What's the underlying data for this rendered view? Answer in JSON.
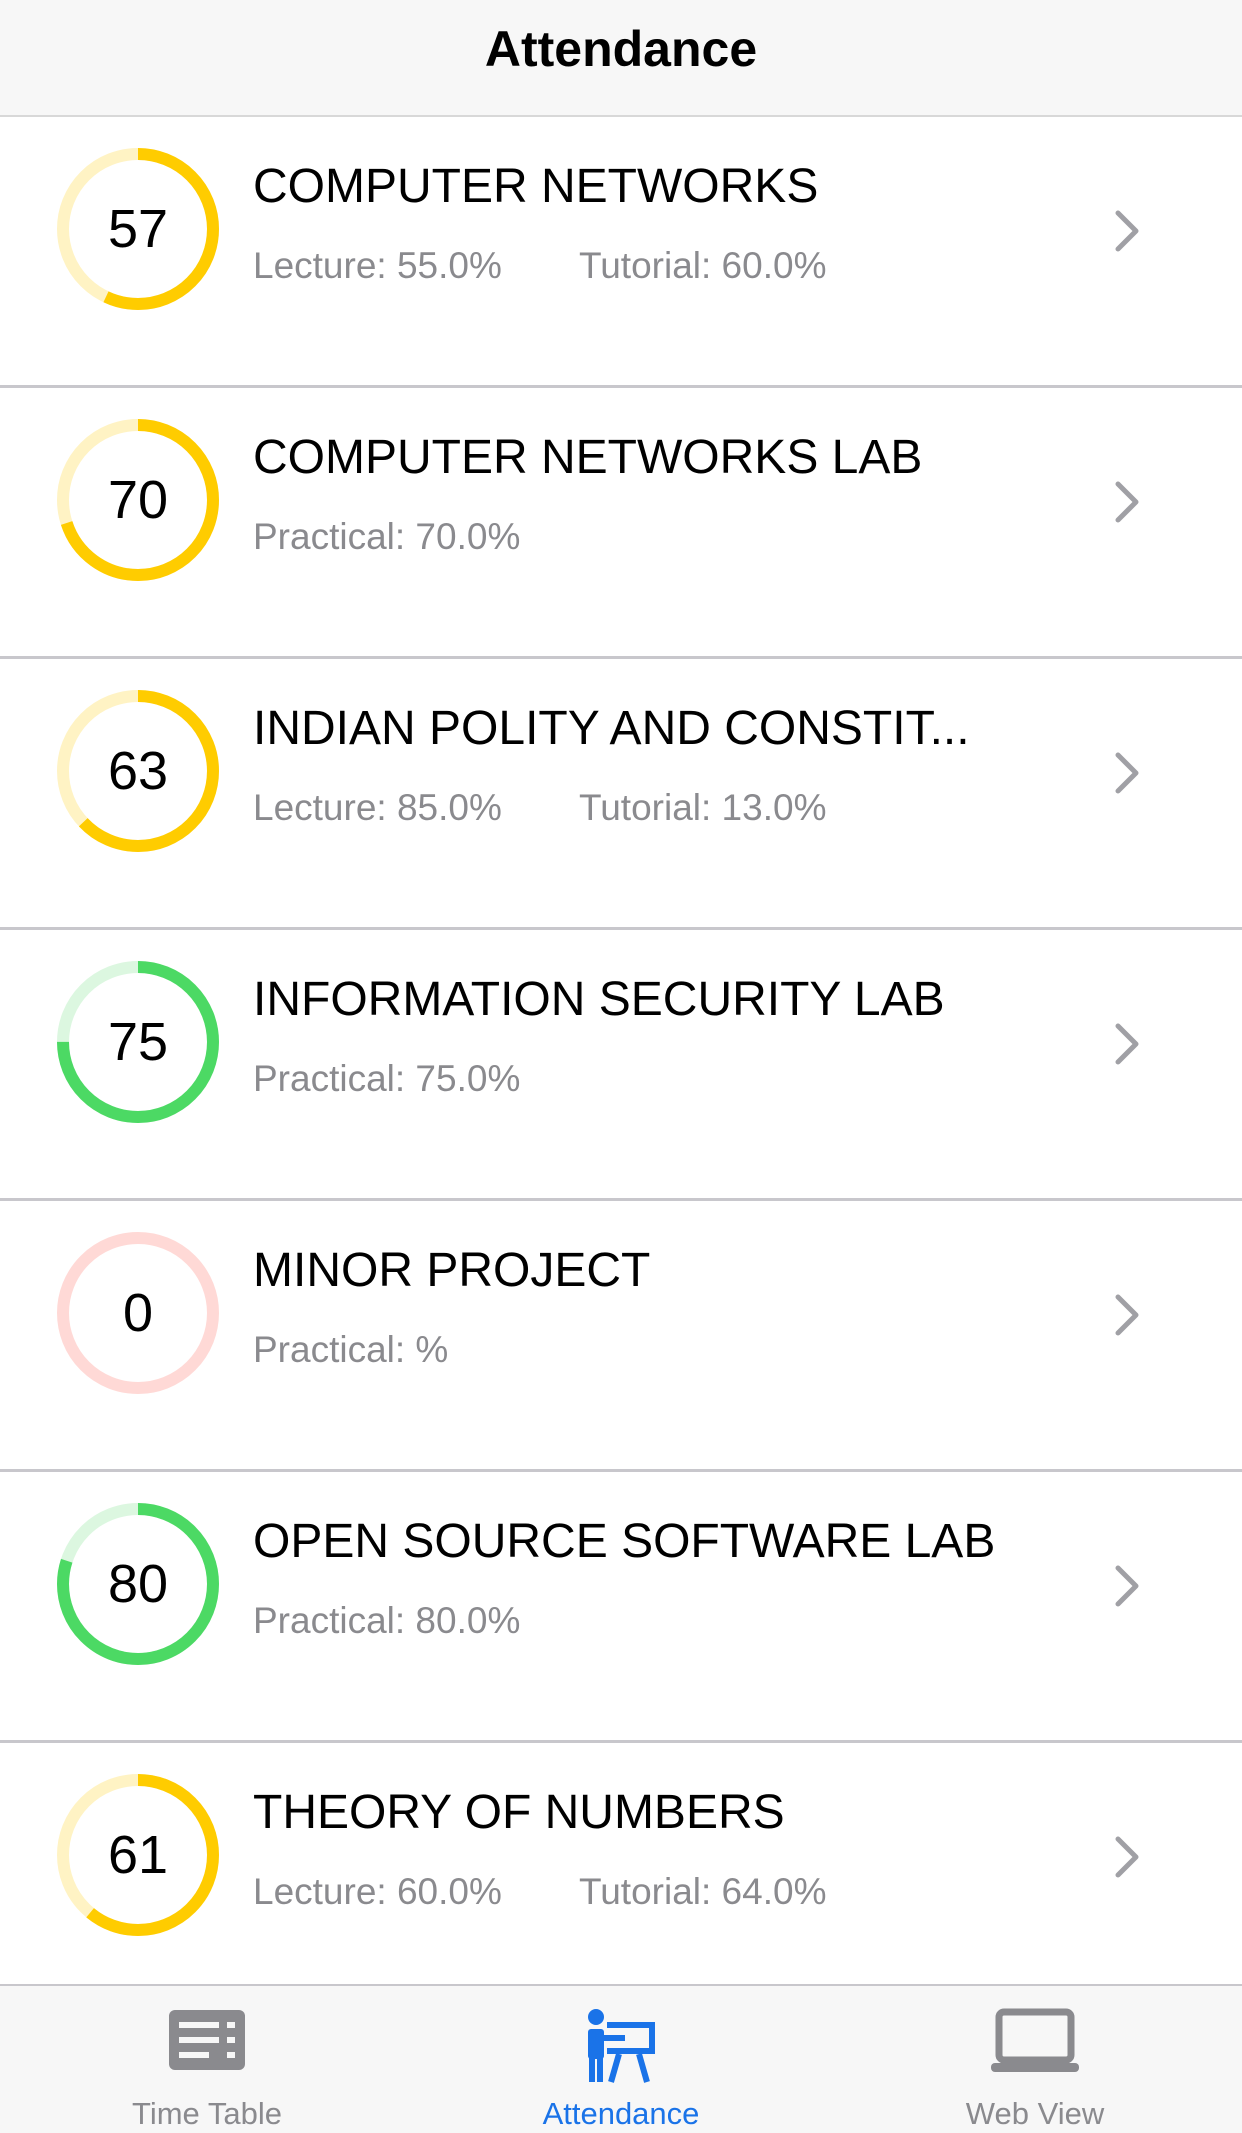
{
  "navbar": {
    "title": "Attendance"
  },
  "colors": {
    "yellow": "#ffcc00",
    "yellow_track": "#fff3c4",
    "green": "#4cd964",
    "green_track": "#dcf7e0",
    "red": "#ff3b30",
    "red_track": "#ffd9d6",
    "active_tab": "#1a73e8",
    "inactive_tab": "#8a8a8e"
  },
  "subjects": [
    {
      "name": "COMPUTER NETWORKS",
      "percent": "57",
      "status": "yellow",
      "detail1": "Lecture: 55.0%",
      "detail2": "Tutorial: 60.0%"
    },
    {
      "name": "COMPUTER NETWORKS LAB",
      "percent": "70",
      "status": "yellow",
      "detail1": "Practical: 70.0%",
      "detail2": ""
    },
    {
      "name": "INDIAN POLITY AND CONSTIT...",
      "percent": "63",
      "status": "yellow",
      "detail1": "Lecture: 85.0%",
      "detail2": "Tutorial: 13.0%"
    },
    {
      "name": "INFORMATION SECURITY LAB",
      "percent": "75",
      "status": "green",
      "detail1": "Practical: 75.0%",
      "detail2": ""
    },
    {
      "name": "MINOR PROJECT",
      "percent": "0",
      "status": "red",
      "detail1": "Practical: %",
      "detail2": ""
    },
    {
      "name": "OPEN SOURCE SOFTWARE LAB",
      "percent": "80",
      "status": "green",
      "detail1": "Practical: 80.0%",
      "detail2": ""
    },
    {
      "name": "THEORY OF NUMBERS",
      "percent": "61",
      "status": "yellow",
      "detail1": "Lecture: 60.0%",
      "detail2": "Tutorial: 64.0%"
    }
  ],
  "tabs": [
    {
      "label": "Time Table",
      "icon": "timetable-icon",
      "active": false
    },
    {
      "label": "Attendance",
      "icon": "presentation-icon",
      "active": true
    },
    {
      "label": "Web View",
      "icon": "laptop-icon",
      "active": false
    }
  ]
}
